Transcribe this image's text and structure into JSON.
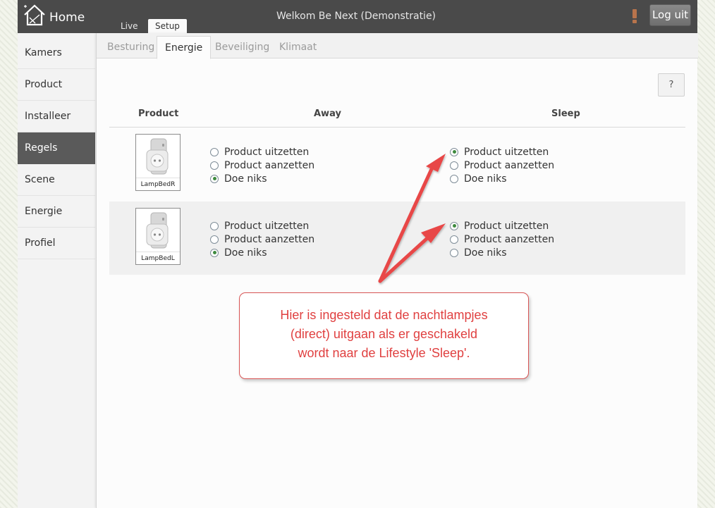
{
  "header": {
    "brand": "Home",
    "tabs": [
      "Live",
      "Setup"
    ],
    "active_tab": "Setup",
    "welcome": "Welkom Be Next (Demonstratie)",
    "logout_label": "Log uit",
    "alert_icon": "exclamation-icon",
    "alert_color": "#b8744c"
  },
  "sidebar": {
    "items": [
      {
        "label": "Kamers"
      },
      {
        "label": "Product"
      },
      {
        "label": "Installeer"
      },
      {
        "label": "Regels",
        "active": true
      },
      {
        "label": "Scene"
      },
      {
        "label": "Energie"
      },
      {
        "label": "Profiel"
      }
    ]
  },
  "subtabs": {
    "items": [
      "Besturing",
      "Energie",
      "Beveiliging",
      "Klimaat"
    ],
    "active": "Energie"
  },
  "help_label": "?",
  "table": {
    "headers": {
      "product": "Product",
      "away": "Away",
      "sleep": "Sleep"
    },
    "rows": [
      {
        "product": "LampBedR",
        "away": {
          "options": [
            "Product uitzetten",
            "Product aanzetten",
            "Doe niks"
          ],
          "selected": "Doe niks"
        },
        "sleep": {
          "options": [
            "Product uitzetten",
            "Product aanzetten",
            "Doe niks"
          ],
          "selected": "Product uitzetten"
        }
      },
      {
        "product": "LampBedL",
        "away": {
          "options": [
            "Product uitzetten",
            "Product aanzetten",
            "Doe niks"
          ],
          "selected": "Doe niks"
        },
        "sleep": {
          "options": [
            "Product uitzetten",
            "Product aanzetten",
            "Doe niks"
          ],
          "selected": "Product uitzetten"
        }
      }
    ]
  },
  "annotation": {
    "lines": [
      "Hier is ingesteld dat de nachtlampjes",
      "(direct) uitgaan als er geschakeld",
      "wordt naar de Lifestyle 'Sleep'."
    ],
    "color": "#e04040"
  },
  "colors": {
    "topbar": "#4a4a4a",
    "sidebar_active": "#5a5a5a",
    "radio_selected": "#3e8a3e"
  }
}
